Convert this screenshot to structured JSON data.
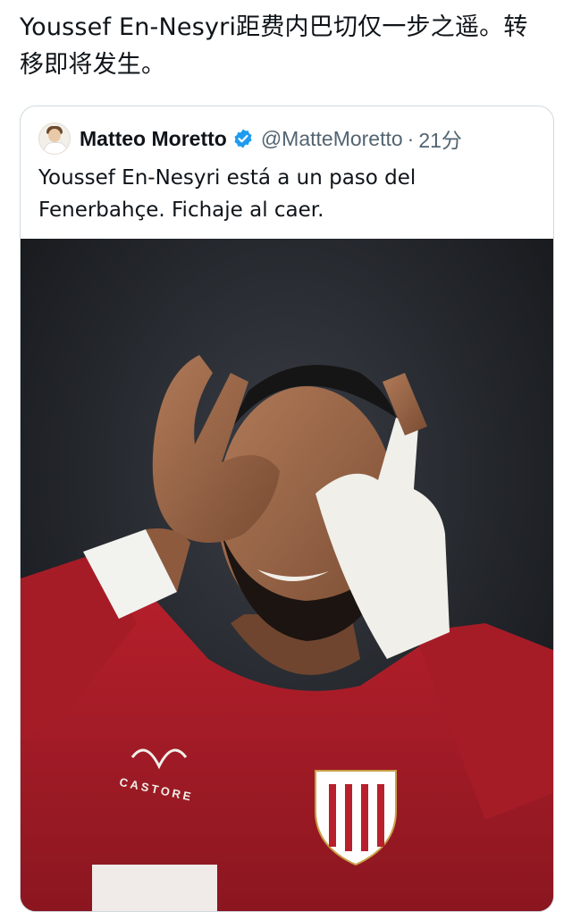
{
  "post": {
    "text": "Youssef En-Nesyri距费内巴切仅一步之遥。转移即将发生。"
  },
  "quoted_tweet": {
    "author_name": "Matteo Moretto",
    "handle": "@MatteMoretto",
    "separator": "·",
    "time": "21分",
    "text": "Youssef En-Nesyri está a un paso del Fenerbahçe. Fichaje al caer.",
    "verified_color": "#1d9bf0"
  },
  "photo": {
    "jersey_brand": "CASTORE"
  }
}
